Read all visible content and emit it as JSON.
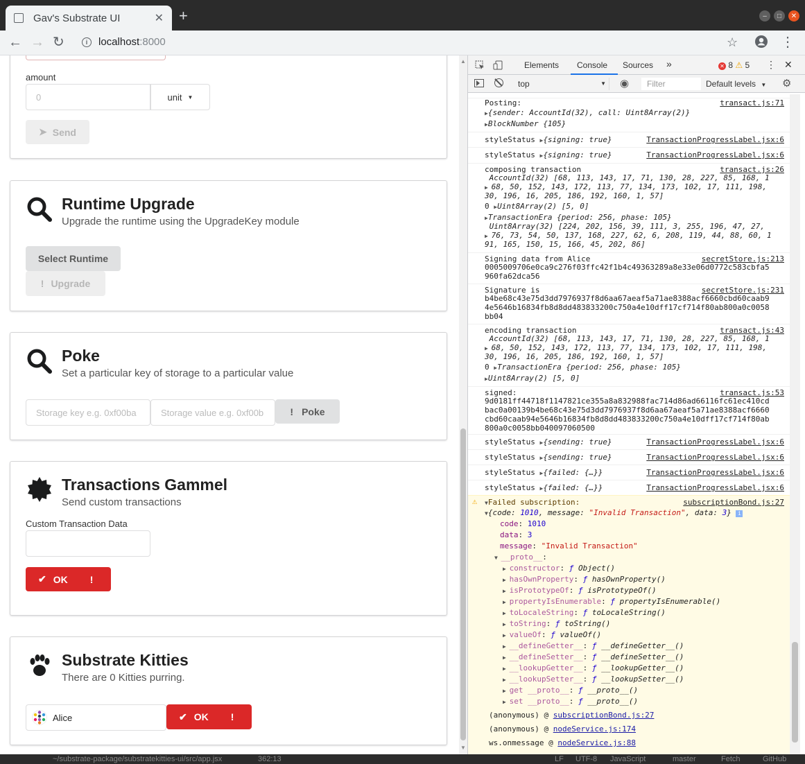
{
  "browser": {
    "tab_title": "Gav's Substrate UI",
    "tab_close": "✕",
    "new_tab": "+",
    "url_host": "localhost",
    "url_port": ":8000"
  },
  "transfer": {
    "amount_label": "amount",
    "amount_placeholder": "0",
    "unit_label": "unit",
    "send_label": "Send"
  },
  "runtime_upgrade": {
    "title": "Runtime Upgrade",
    "subtitle": "Upgrade the runtime using the UpgradeKey module",
    "select_label": "Select Runtime",
    "upgrade_label": "Upgrade"
  },
  "poke": {
    "title": "Poke",
    "subtitle": "Set a particular key of storage to a particular value",
    "key_placeholder": "Storage key e.g. 0xf00ba",
    "value_placeholder": "Storage value e.g. 0xf00b",
    "poke_label": "Poke"
  },
  "transactions": {
    "title": "Transactions Gammel",
    "subtitle": "Send custom transactions",
    "data_label": "Custom Transaction Data",
    "ok_label": "OK"
  },
  "kitties": {
    "title": "Substrate Kitties",
    "subtitle": "There are 0 Kitties purring.",
    "account": "Alice",
    "ok_label": "OK"
  },
  "devtools": {
    "tabs": [
      "Elements",
      "Console",
      "Sources"
    ],
    "errors": "8",
    "warnings": "5",
    "context": "top",
    "filter_placeholder": "Filter",
    "levels": "Default levels"
  },
  "console": {
    "posting": "Posting:",
    "posting_src": "transact.js:71",
    "posting_obj": "{sender: AccountId(32), call: Uint8Array(2)}",
    "posting_block": "BlockNumber {105}",
    "style1": "styleStatus ",
    "style1_obj": "{signing: true}",
    "style_src": "TransactionProgressLabel.jsx:6",
    "style2_obj": "{signing: true}",
    "composing": "composing transaction",
    "composing_src": "transact.js:26",
    "acc_line1": " AccountId(32) [68, 113, 143, 17, 71, 130, 28, 227, 85, 168, 1",
    "acc_line2": "68, 50, 152, 143, 172, 113, 77, 134, 173, 102, 17, 111, 198,",
    "acc_line3": "30, 196, 16, 205, 186, 192, 160, 1, 57]",
    "uint2": "Uint8Array(2) [5, 0]",
    "era": "TransactionEra {period: 256, phase: 105}",
    "sig_line1": " Uint8Array(32) [224, 202, 156, 39, 111, 3, 255, 196, 47, 27,",
    "sig_line2": "76, 73, 54, 50, 137, 168, 227, 62, 6, 208, 119, 44, 88, 60, 1",
    "sig_line3": "91, 165, 150, 15, 166, 45, 202, 86]",
    "signing_data": "Signing data from Alice",
    "secret_src1": "secretStore.js:213",
    "signing_hex1": "0005009706e0ca9c276f03ffc42f1b4c49363289a8e33e06d0772c583cbfa5",
    "signing_hex2": "960fa62dca56",
    "signature_is": "Signature is",
    "secret_src2": "secretStore.js:231",
    "sig_hex1": "b4be68c43e75d3dd7976937f8d6aa67aeaf5a71ae8388acf6660cbd60caab9",
    "sig_hex2": "4e5646b16834fb8d8dd483833200c750a4e10dff17cf714f80ab800a0c0058",
    "sig_hex3": "bb04",
    "encoding": "encoding transaction",
    "encoding_src": "transact.js:43",
    "signed": "signed:",
    "signed_src": "transact.js:53",
    "signed_hex1": "9d0181ff44718f1147821ce355a8a832988fac714d86ad66116fc61ec410cd",
    "signed_hex2": "bac0a00139b4be68c43e75d3dd7976937f8d6aa67aeaf5a71ae8388acf6660",
    "signed_hex3": "cbd60caab94e5646b16834fb8d8dd483833200c750a4e10dff17cf714f80ab",
    "signed_hex4": "800a0c0058bb040097060500",
    "sending_obj": "{sending: true}",
    "failed_obj": "{failed: {…}}",
    "failed_sub": "Failed subscription:",
    "failed_sub_src": "subscriptionBond.js:27",
    "err_obj_a": "{code: ",
    "err_code": "1010",
    "err_obj_b": ", message: ",
    "err_msg": "\"Invalid Transaction\"",
    "err_obj_c": ", data: ",
    "err_data": "3",
    "err_obj_d": "}",
    "k_code": "code",
    "k_data": "data",
    "k_message": "message",
    "k_proto": "__proto__",
    "proto_items": [
      {
        "k": "constructor",
        "v": "Object()"
      },
      {
        "k": "hasOwnProperty",
        "v": "hasOwnProperty()"
      },
      {
        "k": "isPrototypeOf",
        "v": "isPrototypeOf()"
      },
      {
        "k": "propertyIsEnumerable",
        "v": "propertyIsEnumerable()"
      },
      {
        "k": "toLocaleString",
        "v": "toLocaleString()"
      },
      {
        "k": "toString",
        "v": "toString()"
      },
      {
        "k": "valueOf",
        "v": "valueOf()"
      },
      {
        "k": "__defineGetter__",
        "v": "__defineGetter__()"
      },
      {
        "k": "__defineSetter__",
        "v": "__defineSetter__()"
      },
      {
        "k": "__lookupGetter__",
        "v": "__lookupGetter__()"
      },
      {
        "k": "__lookupSetter__",
        "v": "__lookupSetter__()"
      },
      {
        "k": "get __proto__",
        "v": "__proto__()"
      },
      {
        "k": "set __proto__",
        "v": "__proto__()"
      }
    ],
    "stack": [
      {
        "fn": "(anonymous)",
        "src": "subscriptionBond.js:27"
      },
      {
        "fn": "(anonymous)",
        "src": "nodeService.js:174"
      },
      {
        "fn": "ws.onmessage",
        "src": "nodeService.js:88"
      }
    ]
  },
  "statusbar": {
    "path": "~/substrate-package/substratekitties-ui/src/app.jsx",
    "position": "362:13",
    "eol": "LF",
    "encoding": "UTF-8",
    "language": "JavaScript",
    "branch": "master",
    "fetch": "Fetch",
    "github": "GitHub"
  }
}
